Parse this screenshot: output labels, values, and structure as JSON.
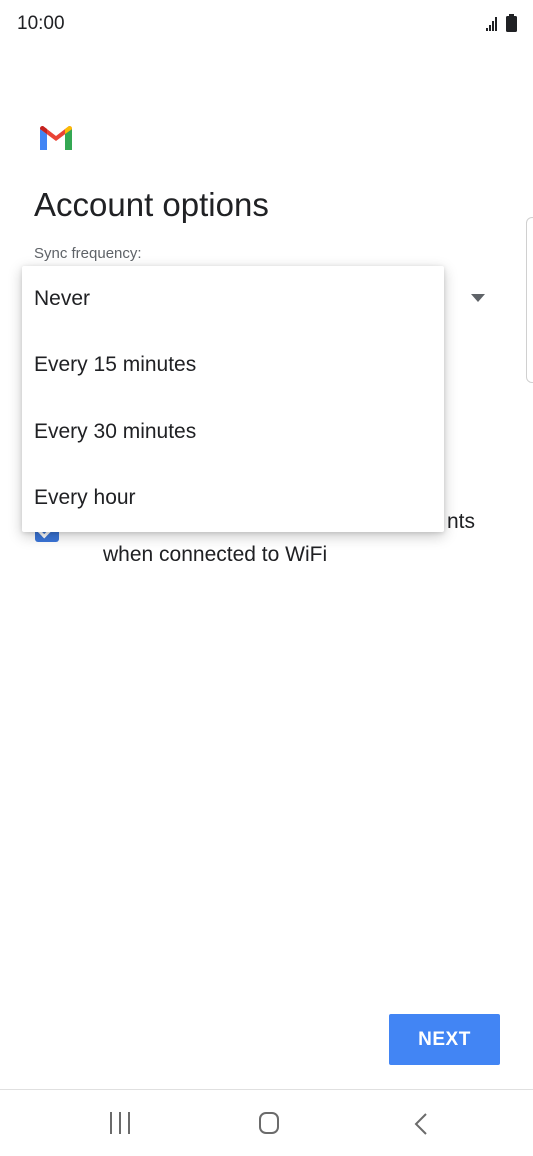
{
  "status_bar": {
    "time": "10:00",
    "icons": [
      "signal-icon",
      "battery-icon"
    ]
  },
  "app": {
    "logo": "gmail-logo",
    "colors": {
      "red": "#ea4335",
      "blue": "#4285f4",
      "yellow": "#fbbc04",
      "green": "#34a853"
    }
  },
  "page": {
    "title": "Account options",
    "sync_label": "Sync frequency:"
  },
  "sync_options": {
    "items": [
      {
        "label": "Never"
      },
      {
        "label": "Every 15 minutes"
      },
      {
        "label": "Every 30 minutes"
      },
      {
        "label": "Every hour"
      }
    ]
  },
  "checkbox": {
    "checked": true,
    "text_line1_visible": "nts",
    "text_line2": "when connected to WiFi"
  },
  "actions": {
    "next_label": "NEXT",
    "accent_color": "#4285f4"
  },
  "nav_bar": {
    "icons": [
      "recents-icon",
      "home-icon",
      "back-icon"
    ]
  }
}
